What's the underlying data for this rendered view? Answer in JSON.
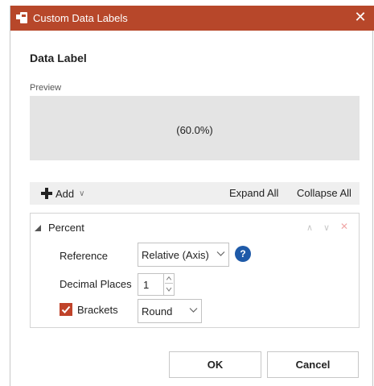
{
  "window": {
    "title": "Custom Data Labels",
    "accent_color": "#b7472a"
  },
  "heading": "Data Label",
  "preview": {
    "label": "Preview",
    "text": "(60.0%)"
  },
  "toolbar": {
    "add_label": "Add",
    "expand_all_label": "Expand All",
    "collapse_all_label": "Collapse All"
  },
  "section": {
    "title": "Percent",
    "reference": {
      "label": "Reference",
      "value": "Relative (Axis)",
      "help": "?"
    },
    "decimal_places": {
      "label": "Decimal Places",
      "value": "1"
    },
    "brackets": {
      "label": "Brackets",
      "checked": true,
      "value": "Round"
    }
  },
  "buttons": {
    "ok": "OK",
    "cancel": "Cancel"
  },
  "icons": {
    "app": "presentation-app-icon",
    "close": "close-icon",
    "add": "plus-icon",
    "help": "help-circle-icon",
    "checkbox": "checkmark-icon"
  }
}
